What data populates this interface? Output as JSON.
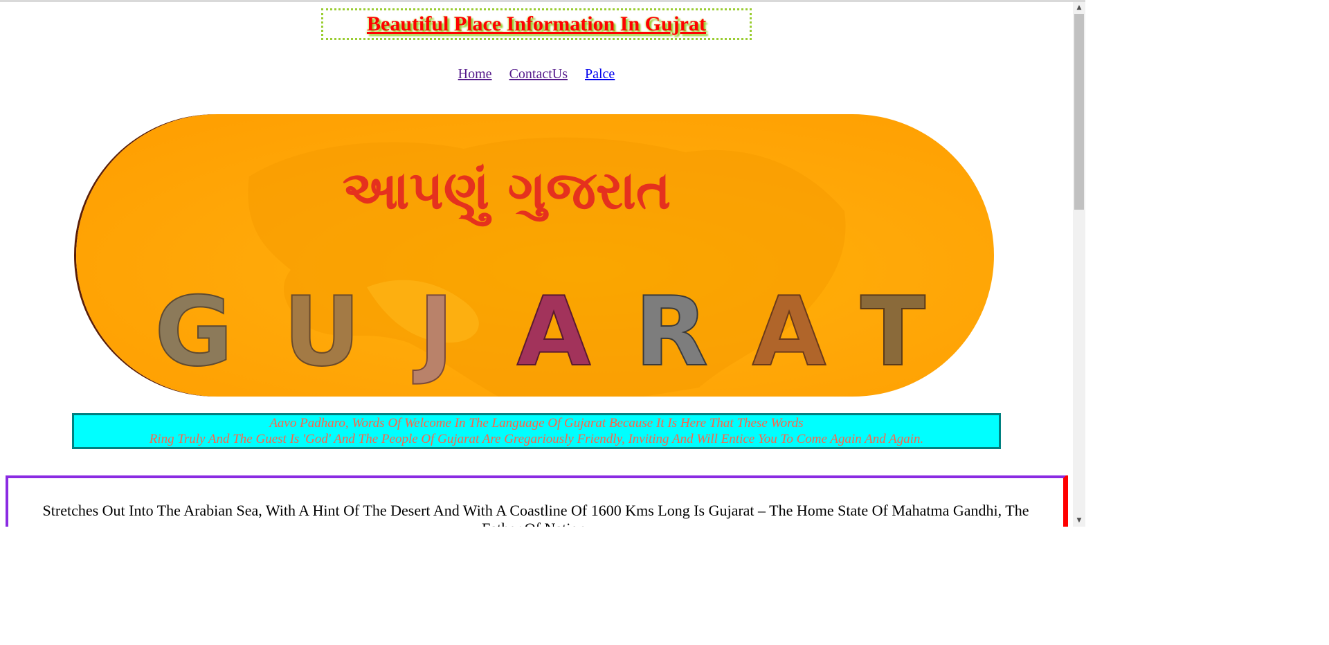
{
  "header": {
    "title": "Beautiful Place Information In Gujrat"
  },
  "nav": {
    "items": [
      {
        "label": "Home",
        "state": "visited"
      },
      {
        "label": "ContactUs",
        "state": "visited"
      },
      {
        "label": "Palce",
        "state": "link"
      }
    ]
  },
  "banner": {
    "gujarati_text": "આપણું ગુજરાત",
    "letters": [
      "G",
      "U",
      "J",
      "A",
      "R",
      "A",
      "T"
    ]
  },
  "welcome": {
    "line1": "Aavo Padharo, Words Of Welcome In The Language Of Gujarat Because It Is Here That These Words",
    "line2": "Ring Truly And The Guest Is 'God' And The People Of Gujarat Are Gregariously Friendly, Inviting And Will Entice You To Come Again And Again."
  },
  "content": {
    "paragraph": "Stretches Out Into The Arabian Sea, With A Hint Of The Desert And With A Coastline Of 1600 Kms Long Is Gujarat – The Home State Of Mahatma Gandhi, The Father Of Nation."
  },
  "colors": {
    "title": "#ff0000",
    "title_border": "#9acd32",
    "welcome_bg": "#00ffff",
    "welcome_border": "#008080",
    "welcome_text": "#ff6347",
    "content_border": "#8a2be2"
  },
  "icons": {
    "scroll_up": "scroll-up-arrow-icon",
    "scroll_down": "scroll-down-arrow-icon"
  }
}
